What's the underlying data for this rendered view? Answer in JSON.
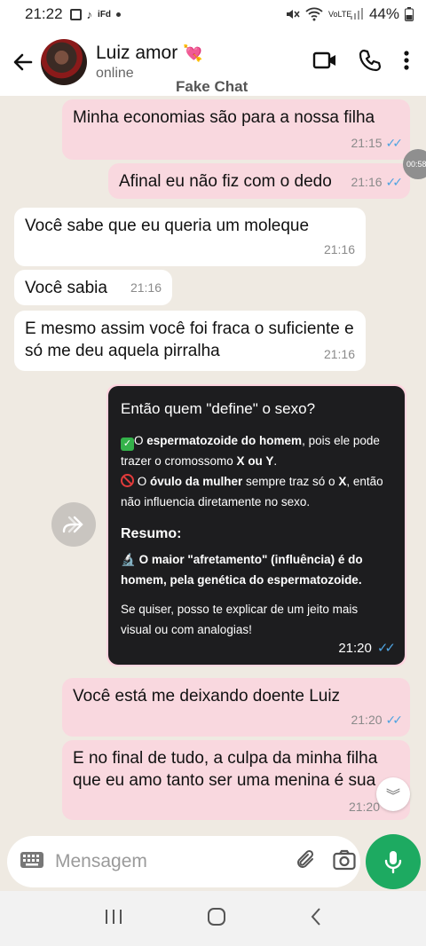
{
  "status": {
    "time": "21:22",
    "left_icons": [
      "gallery-icon",
      "tiktok-icon",
      "ifood-icon"
    ],
    "battery": "44%",
    "network": "VoLTE"
  },
  "header": {
    "contact_name": "Luiz amor",
    "contact_emoji": "💘",
    "contact_status": "online",
    "watermark": "Fake Chat"
  },
  "messages": [
    {
      "dir": "out",
      "text": "Minha economias são para a nossa filha",
      "time": "21:15",
      "read": true
    },
    {
      "dir": "out",
      "text": "Afinal eu não fiz com o dedo",
      "time": "21:16",
      "read": true
    },
    {
      "dir": "in",
      "text": "Você sabe que eu queria um moleque",
      "time": "21:16"
    },
    {
      "dir": "in",
      "text": "Você sabia",
      "time": "21:16"
    },
    {
      "dir": "in",
      "text": "E mesmo assim você foi fraca o suficiente e só me deu aquela pirralha",
      "time": "21:16"
    },
    {
      "dir": "out",
      "text": "Você está me deixando doente Luiz",
      "time": "21:20",
      "read": true
    },
    {
      "dir": "out",
      "text": "E no final de tudo, a culpa da minha filha que eu amo tanto ser uma menina é sua",
      "time": "21:20"
    }
  ],
  "side_pill": "00:58",
  "forwarded_card": {
    "title": "Então quem \"define\" o sexo?",
    "line1_pre": "O ",
    "line1_bold": "espermatozoide do homem",
    "line1_post": ", pois ele pode trazer o cromossomo ",
    "line1_x": "X",
    "line1_ou": " ou ",
    "line1_y": "Y",
    "line1_end": ".",
    "line2_pre": " O ",
    "line2_bold": "óvulo da mulher",
    "line2_mid": " sempre traz só o ",
    "line2_x": "X",
    "line2_end": ", então não influencia diretamente no sexo.",
    "summary_title": "Resumo:",
    "summary_line": "O maior \"afretamento\" (influência) é do homem, pela genética do espermatozoide.",
    "footer": "Se quiser, posso te explicar de um jeito mais visual ou com analogias!",
    "time": "21:20"
  },
  "input": {
    "placeholder": "Mensagem"
  },
  "colors": {
    "outgoing_bubble": "#f9d8df",
    "incoming_bubble": "#ffffff",
    "chat_bg": "#efeae2",
    "mic_button": "#1daa61",
    "read_ticks": "#4fa3e0"
  }
}
